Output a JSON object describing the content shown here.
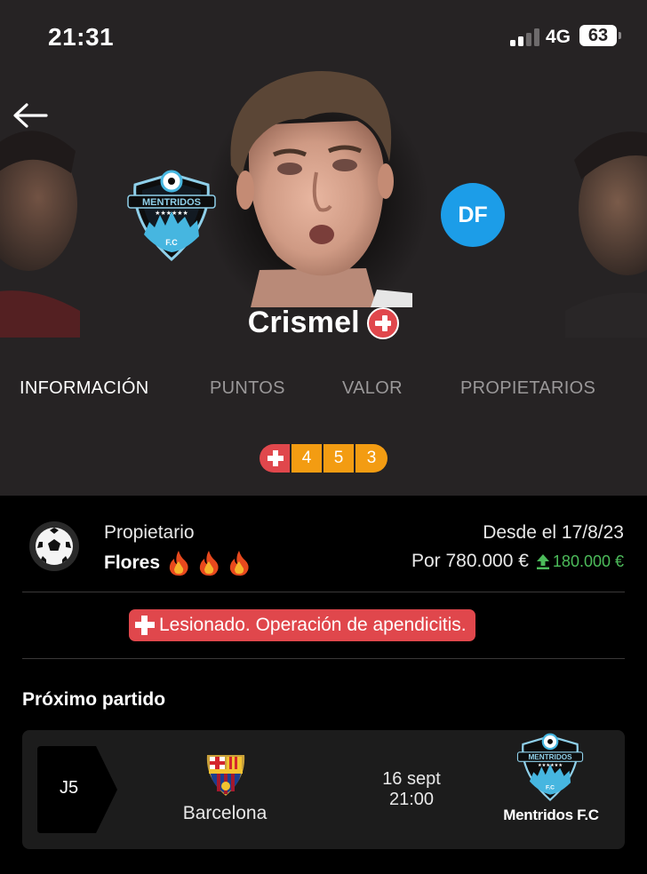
{
  "status_bar": {
    "time": "21:31",
    "network": "4G",
    "battery": "63"
  },
  "player": {
    "name": "Crismel",
    "position": "DF",
    "team_logo_text": "MENTRIDOS F.C",
    "status_color": "#e0474c",
    "position_color": "#1c9de8"
  },
  "tabs": [
    {
      "label": "INFORMACIÓN",
      "active": true
    },
    {
      "label": "PUNTOS",
      "active": false
    },
    {
      "label": "VALOR",
      "active": false
    },
    {
      "label": "PROPIETARIOS",
      "active": false
    }
  ],
  "recent_form": [
    "4",
    "5",
    "3"
  ],
  "owner": {
    "label": "Propietario",
    "name": "Flores",
    "icons": [
      "fire-icon",
      "fire-icon",
      "fire-icon"
    ],
    "since": "Desde el 17/8/23",
    "price": "Por 780.000 €",
    "gain": "180.000 €",
    "gain_color": "#4cbb5a"
  },
  "injury": {
    "text": "Lesionado. Operación de apendicitis."
  },
  "next_match": {
    "title": "Próximo partido",
    "round": "J5",
    "home": "Barcelona",
    "date": "16 sept",
    "time": "21:00",
    "away": "Mentridos F.C"
  }
}
